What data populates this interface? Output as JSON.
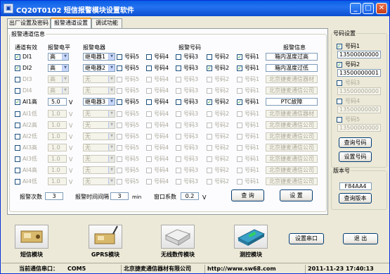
{
  "window": {
    "title": "CQ20T0102  短信报警模块设置软件",
    "icon": "app-icon"
  },
  "tabs": [
    {
      "label": "出厂设置及密码"
    },
    {
      "label": "报警通道设置"
    },
    {
      "label": "调试功能"
    }
  ],
  "alarm": {
    "group_title": "报警通道信息",
    "headers": {
      "valid": "通道有效",
      "level": "报警电平",
      "relay": "报警电器",
      "phone": "报警号码",
      "info": "报警信息"
    },
    "phone_cols": [
      "号码5",
      "号码4",
      "号码3",
      "号码2",
      "号码1"
    ],
    "unit_v": "V",
    "rows": [
      {
        "name": "DI1",
        "checked": true,
        "level": "高",
        "relay": "继电器1",
        "phones": [
          false,
          false,
          false,
          false,
          true
        ],
        "info": "箱内温度过高",
        "enabled": true
      },
      {
        "name": "DI2",
        "checked": true,
        "level": "高",
        "relay": "继电器2",
        "phones": [
          false,
          false,
          false,
          true,
          true
        ],
        "info": "箱内温度过低",
        "enabled": true
      },
      {
        "name": "DI3",
        "checked": false,
        "level": "高",
        "relay": "无",
        "phones": [
          false,
          false,
          false,
          false,
          false
        ],
        "info": "北京捷麦通信器材",
        "enabled": false
      },
      {
        "name": "DI4",
        "checked": false,
        "level": "高",
        "relay": "无",
        "phones": [
          false,
          false,
          false,
          false,
          false
        ],
        "info": "北京捷麦通信公司",
        "enabled": false
      },
      {
        "name": "AI1高",
        "checked": true,
        "level": "5.0",
        "relay": "继电器3",
        "phones": [
          false,
          false,
          false,
          true,
          true
        ],
        "info": "PTC故障",
        "enabled": true
      },
      {
        "name": "AI1低",
        "checked": false,
        "level": "1.0",
        "relay": "无",
        "phones": [
          false,
          false,
          false,
          false,
          false
        ],
        "info": "北京捷麦通信器材",
        "enabled": false
      },
      {
        "name": "AI2高",
        "checked": false,
        "level": "1.0",
        "relay": "无",
        "phones": [
          false,
          false,
          false,
          false,
          false
        ],
        "info": "北京捷麦通信公司",
        "enabled": false
      },
      {
        "name": "AI2低",
        "checked": false,
        "level": "1.0",
        "relay": "无",
        "phones": [
          false,
          false,
          false,
          false,
          false
        ],
        "info": "北京捷麦通信公司",
        "enabled": false
      },
      {
        "name": "AI3高",
        "checked": false,
        "level": "1.0",
        "relay": "无",
        "phones": [
          false,
          false,
          false,
          false,
          false
        ],
        "info": "北京捷麦通信公司",
        "enabled": false
      },
      {
        "name": "AI3低",
        "checked": false,
        "level": "1.0",
        "relay": "无",
        "phones": [
          false,
          false,
          false,
          false,
          false
        ],
        "info": "北京捷麦通信公司",
        "enabled": false
      },
      {
        "name": "AI4高",
        "checked": false,
        "level": "1.0",
        "relay": "无",
        "phones": [
          false,
          false,
          false,
          false,
          false
        ],
        "info": "北京捷麦通信公司",
        "enabled": false
      },
      {
        "name": "AI4低",
        "checked": false,
        "level": "1.0",
        "relay": "无",
        "phones": [
          false,
          false,
          false,
          false,
          false
        ],
        "info": "北京捷麦通信公司",
        "enabled": false
      }
    ]
  },
  "bottom": {
    "count_label": "报警次数",
    "count_value": "3",
    "interval_label": "报警时间间隔",
    "interval_value": "3",
    "interval_unit": "min",
    "window_label": "窗口系数",
    "window_value": "0.2",
    "window_unit": "V",
    "query_btn": "查 询",
    "set_btn": "设 置"
  },
  "numbers": {
    "group_title": "号码设置",
    "items": [
      {
        "label": "号码1",
        "checked": true,
        "value": "13500000000"
      },
      {
        "label": "号码2",
        "checked": true,
        "value": "13500000001"
      },
      {
        "label": "号码3",
        "checked": false,
        "value": "13500000000"
      },
      {
        "label": "号码4",
        "checked": false,
        "value": "13500000000"
      },
      {
        "label": "号码5",
        "checked": false,
        "value": "13500000000"
      }
    ],
    "query_btn": "查询号码",
    "set_btn": "设置号码"
  },
  "version": {
    "group_title": "版本号",
    "value": "F84AA4",
    "btn": "查询版本"
  },
  "modules": [
    {
      "caption": "短信模块"
    },
    {
      "caption": "GPRS模块"
    },
    {
      "caption": "无线数传模块"
    },
    {
      "caption": "测控模块"
    }
  ],
  "actions": {
    "serial_btn": "设置串口",
    "exit_btn": "退 出"
  },
  "status": {
    "serial_label": "当前通信串口：",
    "serial_value": "COM5",
    "company": "北京捷麦通信器材有限公司",
    "url": "http://www.sw68.com",
    "datetime": "2011-11-23  17:40:13"
  }
}
